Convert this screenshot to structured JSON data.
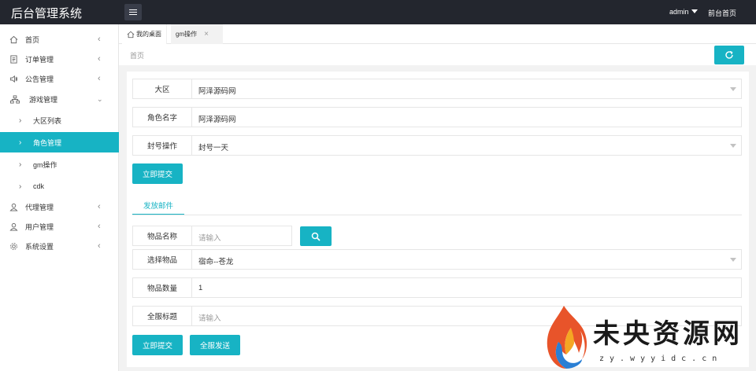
{
  "header": {
    "app_title": "后台管理系统",
    "user": "admin",
    "front_link": "前台首页"
  },
  "sidebar": {
    "items": [
      {
        "label": "首页",
        "icon": "home-icon"
      },
      {
        "label": "订单管理",
        "icon": "document-icon"
      },
      {
        "label": "公告管理",
        "icon": "speaker-icon"
      },
      {
        "label": "游戏管理",
        "icon": "sitemap-icon"
      },
      {
        "label": "代理管理",
        "icon": "user-icon"
      },
      {
        "label": "用户管理",
        "icon": "user-icon"
      },
      {
        "label": "系统设置",
        "icon": "gear-icon"
      }
    ],
    "sub_items": [
      {
        "label": "大区列表"
      },
      {
        "label": "角色管理",
        "active": true
      },
      {
        "label": "gm操作"
      },
      {
        "label": "cdk"
      }
    ]
  },
  "tabs": [
    {
      "label": "我的桌面",
      "icon": "home-icon"
    },
    {
      "label": "gm操作",
      "closable": true
    }
  ],
  "breadcrumb": "首页",
  "form": {
    "region": {
      "label": "大区",
      "value": "阿泽源码网"
    },
    "role_name": {
      "label": "角色名字",
      "value": "阿泽源码网"
    },
    "ban_action": {
      "label": "封号操作",
      "value": "封号一天"
    },
    "submit1": "立即提交",
    "mail_tab": "发放邮件",
    "item_name": {
      "label": "物品名称",
      "placeholder": "请输入"
    },
    "select_item": {
      "label": "选择物品",
      "value": "宿命--苍龙"
    },
    "item_qty": {
      "label": "物品数量",
      "value": "1"
    },
    "server_title": {
      "label": "全服标题",
      "placeholder": "请输入"
    },
    "submit2": "立即提交",
    "send_all": "全服发送"
  },
  "watermark": {
    "title": "未央资源网",
    "url": "zy.wyyidc.cn"
  },
  "colors": {
    "accent": "#17b3c4",
    "header_bg": "#23262e"
  }
}
